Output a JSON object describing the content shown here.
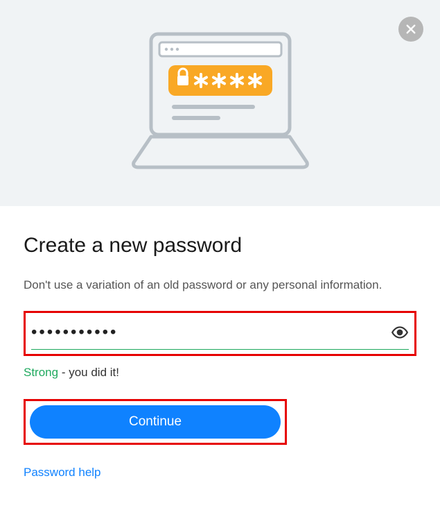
{
  "heading": "Create a new password",
  "subtext": "Don't use a variation of an old password or any personal information.",
  "password_value": "•••••••••••",
  "strength": {
    "label": "Strong",
    "suffix": " - you did it!"
  },
  "continue_label": "Continue",
  "help_label": "Password help"
}
